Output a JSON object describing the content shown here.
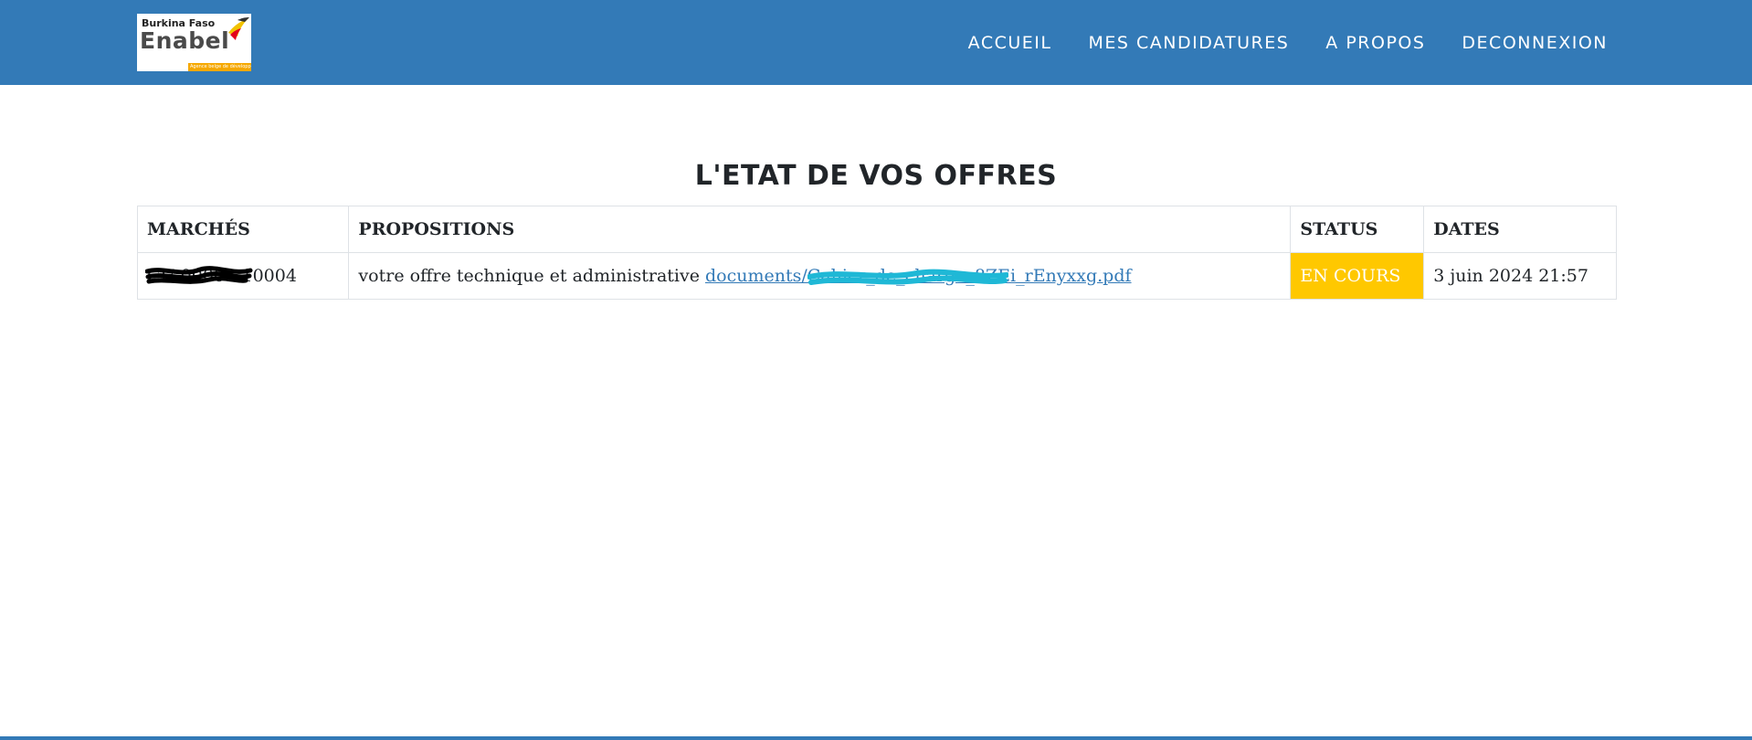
{
  "brand": {
    "logo_top": "Burkina Faso",
    "logo_main": "Enabel",
    "logo_tagline": "Agence belge de développement"
  },
  "nav": {
    "items": [
      {
        "label": "ACCUEIL"
      },
      {
        "label": "MES CANDIDATURES"
      },
      {
        "label": "A PROPOS"
      },
      {
        "label": "DECONNEXION"
      }
    ]
  },
  "page": {
    "title": "L'ETAT DE VOS OFFRES"
  },
  "table": {
    "headers": [
      "MARCHÉS",
      "PROPOSITIONS",
      "STATUS",
      "DATES"
    ],
    "rows": [
      {
        "marche": "CU-00001-10004",
        "proposition_text": "votre offre technique et administrative ",
        "proposition_link": "documents/Cahier_de_charge_8ZEi_rEnyxxg.pdf",
        "status": "EN COURS",
        "date": "3 juin 2024 21:57"
      }
    ]
  },
  "colors": {
    "navbar": "#337ab7",
    "status_pending": "#ffc800",
    "link": "#337ab7",
    "redaction_black": "#000000",
    "redaction_cyan": "#1fb8d6"
  }
}
